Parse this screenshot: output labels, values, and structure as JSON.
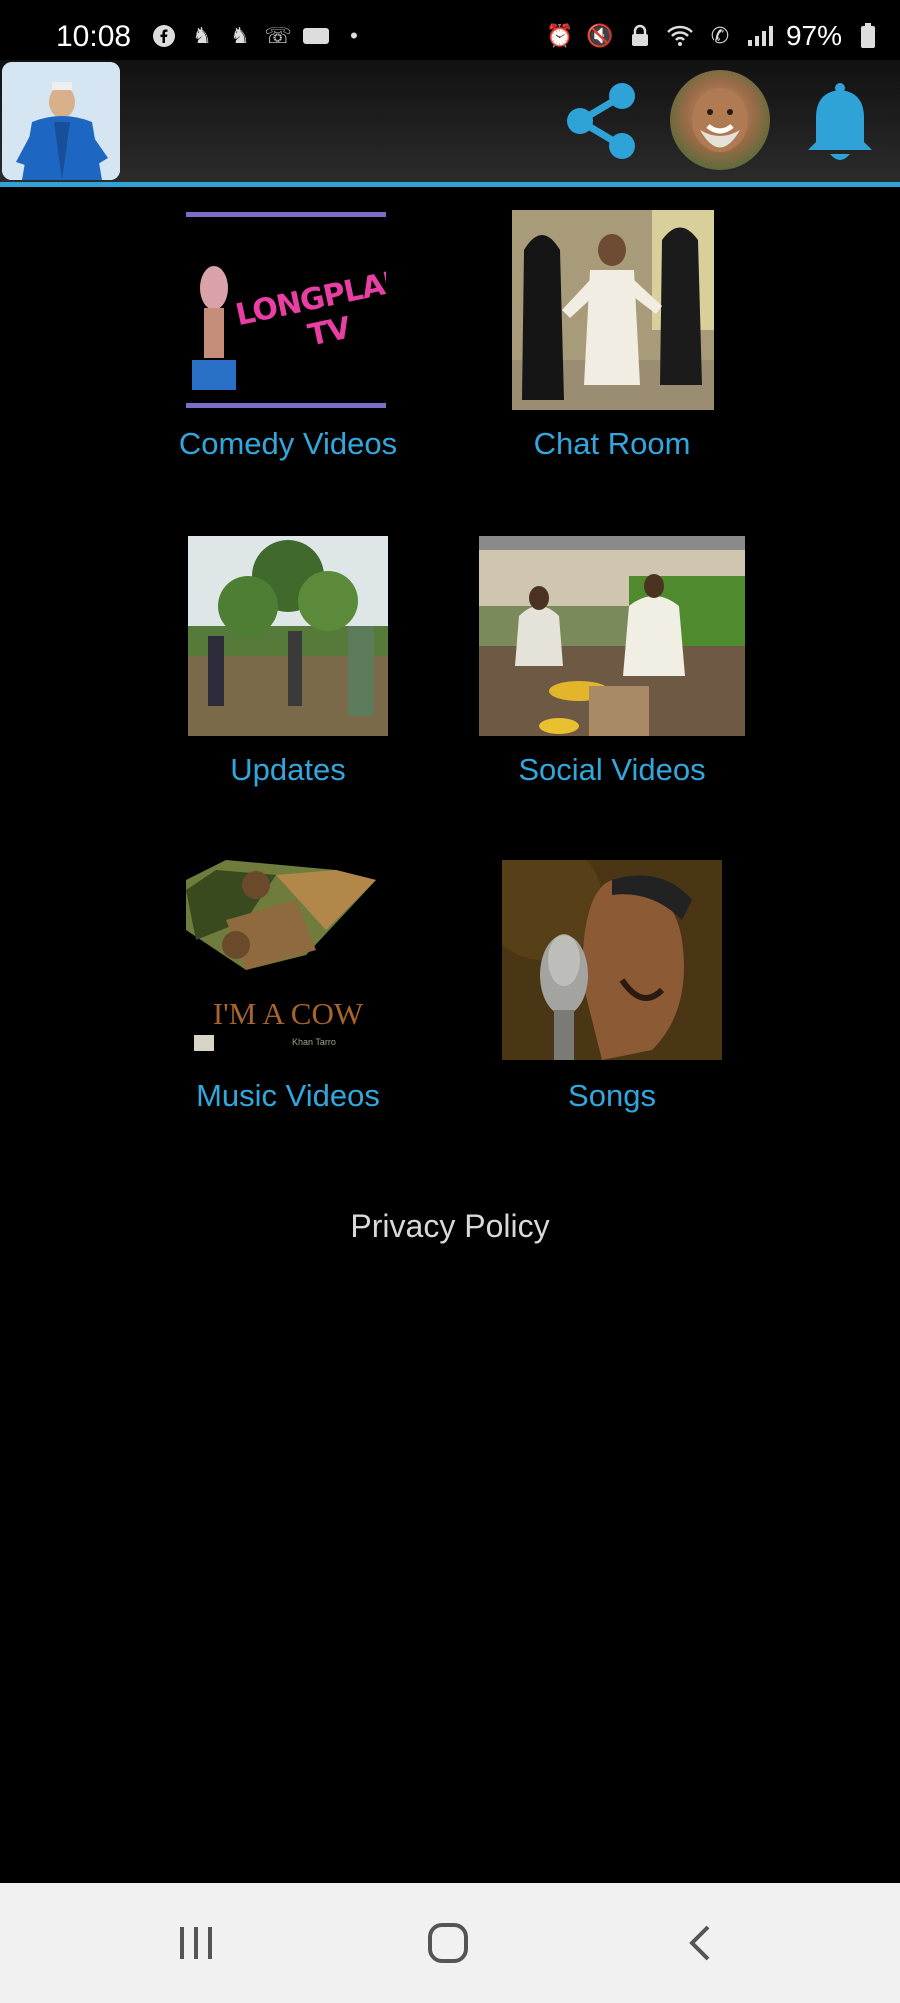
{
  "status_bar": {
    "time": "10:08",
    "battery": "97%",
    "left_icons": [
      "facebook-icon",
      "horse-icon",
      "horse-icon",
      "voicemail-icon",
      "badge-icon",
      "dot-icon"
    ],
    "right_icons": [
      "alarm-icon",
      "mute-icon",
      "lock-icon",
      "wifi-icon",
      "call-icon",
      "signal-icon",
      "battery-icon"
    ]
  },
  "app_bar": {
    "share_icon": "share-icon",
    "bell_icon": "bell-icon",
    "accent": "#2fa3d8"
  },
  "menu": {
    "comedy_videos": "Comedy Videos",
    "comedy_thumb_text": "LONGPLAN TV",
    "chat_room": "Chat Room",
    "updates": "Updates",
    "social_videos": "Social Videos",
    "music_videos": "Music Videos",
    "music_thumb_title": "I'M A COW",
    "music_thumb_sub": "Khan Tarro",
    "songs": "Songs"
  },
  "privacy_policy": "Privacy Policy",
  "nav": {
    "recents_icon": "recents-icon",
    "home_icon": "home-icon",
    "back_icon": "back-icon"
  },
  "colors": {
    "label": "#32a7de",
    "background": "#000000"
  }
}
